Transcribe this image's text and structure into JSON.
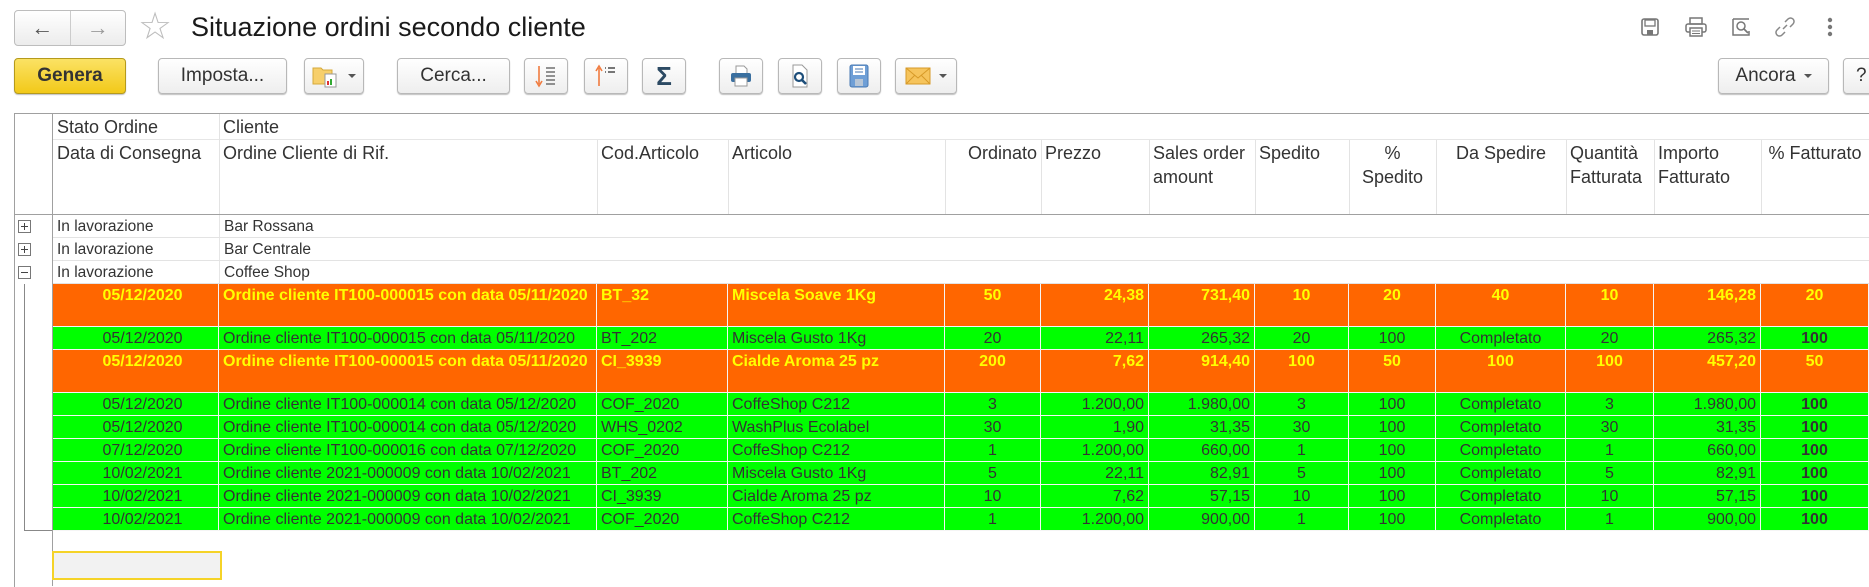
{
  "window": {
    "title": "Situazione ordini secondo cliente",
    "nav": {
      "back_icon": "arrow-left",
      "forward_icon": "arrow-right"
    },
    "favorite_icon": "star-outline",
    "top_icons": [
      "save-icon",
      "print-icon",
      "preview-icon",
      "link-icon",
      "more-vertical-icon"
    ]
  },
  "toolbar": {
    "genera": "Genera",
    "imposta": "Imposta...",
    "variants_icon": "folder-report",
    "cerca": "Cerca...",
    "sort_desc_icon": "sort-descending",
    "sort_asc_icon": "sort-ascending",
    "sum_glyph": "Σ",
    "print_icon": "printer",
    "preview_icon": "page-magnifier",
    "save_icon": "floppy-disk",
    "mail_icon": "envelope",
    "ancora": "Ancora",
    "help": "?"
  },
  "table": {
    "header_top": {
      "col1": "Stato Ordine",
      "col2": "Cliente"
    },
    "columns": [
      "Data di Consegna",
      "Ordine Cliente di Rif.",
      "Cod.Articolo",
      "Articolo",
      "Ordinato",
      "Prezzo",
      "Sales order amount",
      "Spedito",
      "% Spedito",
      "Da Spedire",
      "Quantità Fatturata",
      "Importo Fatturato",
      "% Fatturato"
    ],
    "groups": [
      {
        "state": "In lavorazione",
        "client": "Bar Rossana",
        "expanded": false
      },
      {
        "state": "In lavorazione",
        "client": "Bar Centrale",
        "expanded": false
      },
      {
        "state": "In lavorazione",
        "client": "Coffee Shop",
        "expanded": true
      }
    ],
    "rows": [
      {
        "status": "partial",
        "date": "05/12/2020",
        "order": "Ordine cliente IT100-000015 con data 05/11/2020",
        "code": "BT_32",
        "item": "Miscela Soave 1Kg",
        "ordered": "50",
        "price": "24,38",
        "amount": "731,40",
        "shipped": "10",
        "pct_shipped": "20",
        "to_ship": "40",
        "qty_invoiced": "10",
        "invoiced": "146,28",
        "pct_invoiced": "20"
      },
      {
        "status": "complete",
        "date": "05/12/2020",
        "order": "Ordine cliente IT100-000015 con data 05/11/2020",
        "code": "BT_202",
        "item": "Miscela Gusto 1Kg",
        "ordered": "20",
        "price": "22,11",
        "amount": "265,32",
        "shipped": "20",
        "pct_shipped": "100",
        "to_ship": "Completato",
        "qty_invoiced": "20",
        "invoiced": "265,32",
        "pct_invoiced": "100"
      },
      {
        "status": "partial",
        "date": "05/12/2020",
        "order": "Ordine cliente IT100-000015 con data 05/11/2020",
        "code": "CI_3939",
        "item": "Cialde Aroma 25 pz",
        "ordered": "200",
        "price": "7,62",
        "amount": "914,40",
        "shipped": "100",
        "pct_shipped": "50",
        "to_ship": "100",
        "qty_invoiced": "100",
        "invoiced": "457,20",
        "pct_invoiced": "50"
      },
      {
        "status": "complete",
        "date": "05/12/2020",
        "order": "Ordine cliente IT100-000014 con data 05/12/2020",
        "code": "COF_2020",
        "item": "CoffeShop C212",
        "ordered": "3",
        "price": "1.200,00",
        "amount": "1.980,00",
        "shipped": "3",
        "pct_shipped": "100",
        "to_ship": "Completato",
        "qty_invoiced": "3",
        "invoiced": "1.980,00",
        "pct_invoiced": "100"
      },
      {
        "status": "complete",
        "date": "05/12/2020",
        "order": "Ordine cliente IT100-000014 con data 05/12/2020",
        "code": "WHS_0202",
        "item": "WashPlus Ecolabel",
        "ordered": "30",
        "price": "1,90",
        "amount": "31,35",
        "shipped": "30",
        "pct_shipped": "100",
        "to_ship": "Completato",
        "qty_invoiced": "30",
        "invoiced": "31,35",
        "pct_invoiced": "100"
      },
      {
        "status": "complete",
        "date": "07/12/2020",
        "order": "Ordine cliente IT100-000016 con data 07/12/2020",
        "code": "COF_2020",
        "item": "CoffeShop C212",
        "ordered": "1",
        "price": "1.200,00",
        "amount": "660,00",
        "shipped": "1",
        "pct_shipped": "100",
        "to_ship": "Completato",
        "qty_invoiced": "1",
        "invoiced": "660,00",
        "pct_invoiced": "100"
      },
      {
        "status": "complete",
        "date": "10/02/2021",
        "order": "Ordine cliente 2021-000009 con data 10/02/2021",
        "code": "BT_202",
        "item": "Miscela Gusto 1Kg",
        "ordered": "5",
        "price": "22,11",
        "amount": "82,91",
        "shipped": "5",
        "pct_shipped": "100",
        "to_ship": "Completato",
        "qty_invoiced": "5",
        "invoiced": "82,91",
        "pct_invoiced": "100"
      },
      {
        "status": "complete",
        "date": "10/02/2021",
        "order": "Ordine cliente 2021-000009 con data 10/02/2021",
        "code": "CI_3939",
        "item": "Cialde Aroma 25 pz",
        "ordered": "10",
        "price": "7,62",
        "amount": "57,15",
        "shipped": "10",
        "pct_shipped": "100",
        "to_ship": "Completato",
        "qty_invoiced": "10",
        "invoiced": "57,15",
        "pct_invoiced": "100"
      },
      {
        "status": "complete",
        "date": "10/02/2021",
        "order": "Ordine cliente 2021-000009 con data 10/02/2021",
        "code": "COF_2020",
        "item": "CoffeShop C212",
        "ordered": "1",
        "price": "1.200,00",
        "amount": "900,00",
        "shipped": "1",
        "pct_shipped": "100",
        "to_ship": "Completato",
        "qty_invoiced": "1",
        "invoiced": "900,00",
        "pct_invoiced": "100"
      }
    ]
  },
  "colors": {
    "partial_row_bg": "#ff6600",
    "partial_row_text": "#ffff00",
    "complete_row_bg": "#00ff00",
    "primary_button": "#f5d02b"
  }
}
